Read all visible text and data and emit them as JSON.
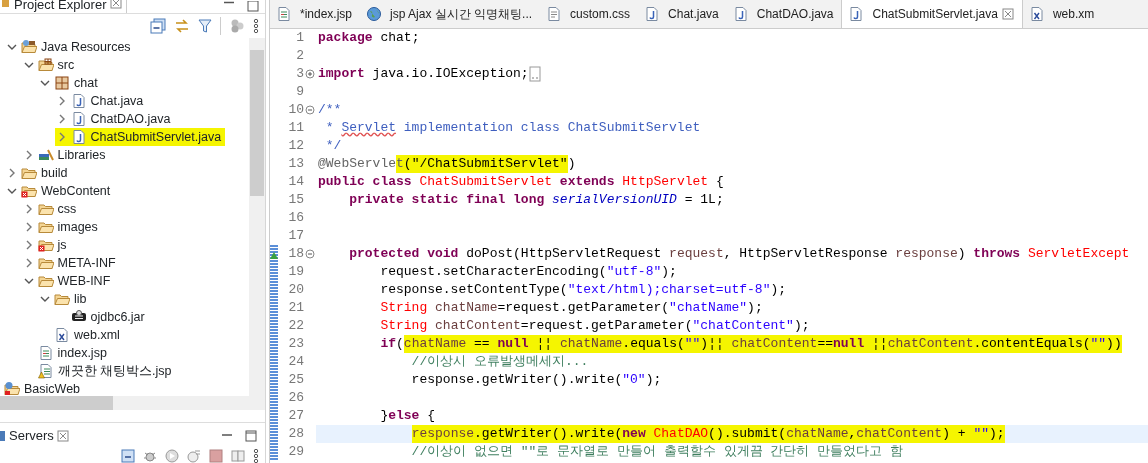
{
  "explorer": {
    "title": "Project Explorer",
    "tree": [
      {
        "label": "Java Resources",
        "kind": "javares",
        "expanded": true,
        "highlighted": false,
        "children": [
          {
            "label": "src",
            "kind": "srcfolder",
            "expanded": true,
            "highlighted": false,
            "children": [
              {
                "label": "chat",
                "kind": "package",
                "expanded": true,
                "highlighted": false,
                "children": [
                  {
                    "label": "Chat.java",
                    "kind": "java",
                    "expanded": false,
                    "highlighted": false
                  },
                  {
                    "label": "ChatDAO.java",
                    "kind": "java",
                    "expanded": false,
                    "highlighted": false
                  },
                  {
                    "label": "ChatSubmitServlet.java",
                    "kind": "java",
                    "expanded": false,
                    "highlighted": true
                  }
                ]
              }
            ]
          },
          {
            "label": "Libraries",
            "kind": "libraries",
            "expanded": false,
            "highlighted": false
          }
        ]
      },
      {
        "label": "build",
        "kind": "folder",
        "expanded": false,
        "highlighted": false
      },
      {
        "label": "WebContent",
        "kind": "webfolder",
        "expanded": true,
        "highlighted": false,
        "children": [
          {
            "label": "css",
            "kind": "folder",
            "expanded": false,
            "highlighted": false
          },
          {
            "label": "images",
            "kind": "folder",
            "expanded": false,
            "highlighted": false
          },
          {
            "label": "js",
            "kind": "webfolder",
            "expanded": false,
            "highlighted": false
          },
          {
            "label": "META-INF",
            "kind": "folder",
            "expanded": false,
            "highlighted": false
          },
          {
            "label": "WEB-INF",
            "kind": "folder",
            "expanded": true,
            "highlighted": false,
            "children": [
              {
                "label": "lib",
                "kind": "folder",
                "expanded": true,
                "highlighted": false,
                "children": [
                  {
                    "label": "ojdbc6.jar",
                    "kind": "jar",
                    "highlighted": false
                  }
                ]
              },
              {
                "label": "web.xml",
                "kind": "xml",
                "highlighted": false
              }
            ]
          },
          {
            "label": "index.jsp",
            "kind": "jsp",
            "highlighted": false
          },
          {
            "label": "깨끗한 채팅박스.jsp",
            "kind": "jspwarn",
            "highlighted": false
          }
        ]
      }
    ],
    "projects": [
      {
        "label": "BasicWeb",
        "kind": "project"
      }
    ]
  },
  "servers": {
    "title": "Servers"
  },
  "editor": {
    "tabs": [
      {
        "label": "*index.jsp",
        "kind": "jsp",
        "selected": false
      },
      {
        "label": "jsp Ajax 실시간 익명채팅...",
        "kind": "globe",
        "selected": false
      },
      {
        "label": "custom.css",
        "kind": "css",
        "selected": false
      },
      {
        "label": "Chat.java",
        "kind": "java",
        "selected": false
      },
      {
        "label": "ChatDAO.java",
        "kind": "java",
        "selected": false
      },
      {
        "label": "ChatSubmitServlet.java",
        "kind": "java",
        "selected": true
      },
      {
        "label": "web.xm",
        "kind": "xml",
        "selected": false
      }
    ],
    "lines": [
      {
        "n": "1",
        "range": false,
        "current": false,
        "tokens": [
          {
            "text": "package ",
            "kind": "kw",
            "highlighted": false
          },
          {
            "text": "chat;",
            "kind": "plain",
            "highlighted": false
          }
        ]
      },
      {
        "n": "2",
        "range": false,
        "current": false
      },
      {
        "n": "3",
        "fold": {
          "collapsed": true
        },
        "folded": true,
        "range": false,
        "current": false,
        "tokens": [
          {
            "text": "import ",
            "kind": "kw",
            "highlighted": false
          },
          {
            "text": "java.io.IOException;",
            "kind": "plain",
            "highlighted": false
          }
        ]
      },
      {
        "n": "9",
        "range": false,
        "current": false
      },
      {
        "n": "10",
        "fold": {
          "collapsed": false
        },
        "range": false,
        "current": false,
        "tokens": [
          {
            "text": "/**",
            "kind": "javadoc",
            "highlighted": false
          }
        ]
      },
      {
        "n": "11",
        "range": false,
        "current": false,
        "tokens": [
          {
            "text": " * ",
            "kind": "javadoc",
            "highlighted": false
          },
          {
            "text": "Servlet",
            "kind": "misspelled",
            "highlighted": false
          },
          {
            "text": " implementation class ChatSubmitServlet",
            "kind": "javadoc",
            "highlighted": false
          }
        ]
      },
      {
        "n": "12",
        "range": false,
        "current": false,
        "tokens": [
          {
            "text": " */",
            "kind": "javadoc",
            "highlighted": false
          }
        ]
      },
      {
        "n": "13",
        "range": false,
        "current": false,
        "tokens": [
          {
            "text": "@WebServle",
            "kind": "annotation",
            "highlighted": false
          },
          {
            "text": "t",
            "kind": "annotation",
            "highlighted": true
          },
          {
            "text": "(\"/ChatSubmitServlet\"",
            "kind": "plain",
            "highlighted": true
          },
          {
            "text": ")",
            "kind": "plain",
            "highlighted": false
          }
        ]
      },
      {
        "n": "14",
        "range": false,
        "current": false,
        "tokens": [
          {
            "text": "public class ",
            "kind": "kw",
            "highlighted": false
          },
          {
            "text": "ChatSubmitServlet ",
            "kind": "type",
            "highlighted": false
          },
          {
            "text": "extends ",
            "kind": "kw",
            "highlighted": false
          },
          {
            "text": "HttpServlet",
            "kind": "type",
            "highlighted": false
          },
          {
            "text": " {",
            "kind": "plain",
            "highlighted": false
          }
        ]
      },
      {
        "n": "15",
        "range": false,
        "current": false,
        "tokens": [
          {
            "text": "    private static final long ",
            "kind": "kw",
            "highlighted": false
          },
          {
            "text": "serialVersionUID",
            "kind": "field",
            "highlighted": false
          },
          {
            "text": " = 1L;",
            "kind": "plain",
            "highlighted": false
          }
        ]
      },
      {
        "n": "16",
        "range": false,
        "current": false
      },
      {
        "n": "17",
        "range": false,
        "current": false
      },
      {
        "n": "18",
        "fold": {
          "collapsed": false
        },
        "override": true,
        "range": true,
        "current": false,
        "tokens": [
          {
            "text": "    protected void",
            "kind": "kw",
            "highlighted": false
          },
          {
            "text": " doPost(HttpServletRequest ",
            "kind": "plain",
            "highlighted": false
          },
          {
            "text": "request",
            "kind": "var",
            "highlighted": false
          },
          {
            "text": ", HttpServletResponse ",
            "kind": "plain",
            "highlighted": false
          },
          {
            "text": "response",
            "kind": "var",
            "highlighted": false
          },
          {
            "text": ") ",
            "kind": "plain",
            "highlighted": false
          },
          {
            "text": "throws ",
            "kind": "kw",
            "highlighted": false
          },
          {
            "text": "ServletExcept",
            "kind": "type",
            "highlighted": false
          }
        ]
      },
      {
        "n": "19",
        "range": true,
        "current": false,
        "tokens": [
          {
            "text": "        request.setCharacterEncoding(",
            "kind": "plain",
            "highlighted": false
          },
          {
            "text": "\"utf-8\"",
            "kind": "str",
            "highlighted": false
          },
          {
            "text": ");",
            "kind": "plain",
            "highlighted": false
          }
        ]
      },
      {
        "n": "20",
        "range": true,
        "current": false,
        "tokens": [
          {
            "text": "        response.setContentType(",
            "kind": "plain",
            "highlighted": false
          },
          {
            "text": "\"text/html);charset=utf-8\"",
            "kind": "str",
            "highlighted": false
          },
          {
            "text": ");",
            "kind": "plain",
            "highlighted": false
          }
        ]
      },
      {
        "n": "21",
        "range": true,
        "current": false,
        "tokens": [
          {
            "text": "        String ",
            "kind": "type",
            "highlighted": false
          },
          {
            "text": "chatName",
            "kind": "var",
            "highlighted": false
          },
          {
            "text": "=request.getParameter(",
            "kind": "plain",
            "highlighted": false
          },
          {
            "text": "\"chatName\"",
            "kind": "str",
            "highlighted": false
          },
          {
            "text": ");",
            "kind": "plain",
            "highlighted": false
          }
        ]
      },
      {
        "n": "22",
        "range": true,
        "current": false,
        "tokens": [
          {
            "text": "        String ",
            "kind": "type",
            "highlighted": false
          },
          {
            "text": "chatContent",
            "kind": "var",
            "highlighted": false
          },
          {
            "text": "=request.getParameter(",
            "kind": "plain",
            "highlighted": false
          },
          {
            "text": "\"chatContent\"",
            "kind": "str",
            "highlighted": false
          },
          {
            "text": ");",
            "kind": "plain",
            "highlighted": false
          }
        ]
      },
      {
        "n": "23",
        "range": true,
        "current": false,
        "tokens": [
          {
            "text": "        if",
            "kind": "kw",
            "highlighted": false
          },
          {
            "text": "(",
            "kind": "plain",
            "highlighted": false
          },
          {
            "text": "chatName",
            "kind": "var",
            "highlighted": true
          },
          {
            "text": " == ",
            "kind": "plain",
            "highlighted": true
          },
          {
            "text": "null",
            "kind": "kw",
            "highlighted": true
          },
          {
            "text": " ¦¦ ",
            "kind": "plain",
            "highlighted": true
          },
          {
            "text": "chatName",
            "kind": "var",
            "highlighted": true
          },
          {
            "text": ".equals(",
            "kind": "plain",
            "highlighted": true
          },
          {
            "text": "\"\"",
            "kind": "str",
            "highlighted": true
          },
          {
            "text": ")¦¦ ",
            "kind": "plain",
            "highlighted": true
          },
          {
            "text": "chatContent",
            "kind": "var",
            "highlighted": true
          },
          {
            "text": "==",
            "kind": "plain",
            "highlighted": true
          },
          {
            "text": "null",
            "kind": "kw",
            "highlighted": true
          },
          {
            "text": " ¦¦",
            "kind": "plain",
            "highlighted": true
          },
          {
            "text": "chatContent",
            "kind": "var",
            "highlighted": true
          },
          {
            "text": ".contentEquals(",
            "kind": "plain",
            "highlighted": true
          },
          {
            "text": "\"\"",
            "kind": "str",
            "highlighted": true
          },
          {
            "text": "))",
            "kind": "plain",
            "highlighted": true
          }
        ]
      },
      {
        "n": "24",
        "range": true,
        "current": false,
        "tokens": [
          {
            "text": "            //이상시 오류발생메세지...",
            "kind": "comment",
            "highlighted": false
          }
        ]
      },
      {
        "n": "25",
        "range": true,
        "current": false,
        "tokens": [
          {
            "text": "            response.getWriter().write(",
            "kind": "plain",
            "highlighted": false
          },
          {
            "text": "\"0\"",
            "kind": "str",
            "highlighted": false
          },
          {
            "text": ");",
            "kind": "plain",
            "highlighted": false
          }
        ]
      },
      {
        "n": "26",
        "range": true,
        "current": false
      },
      {
        "n": "27",
        "range": true,
        "current": false,
        "tokens": [
          {
            "text": "        }",
            "kind": "plain",
            "highlighted": false
          },
          {
            "text": "else",
            "kind": "kw",
            "highlighted": false
          },
          {
            "text": " {",
            "kind": "plain",
            "highlighted": false
          }
        ]
      },
      {
        "n": "28",
        "range": true,
        "current": true,
        "tokens": [
          {
            "text": "            response",
            "kind": "var",
            "highlighted": true
          },
          {
            "text": ".getWriter().write(",
            "kind": "plain",
            "highlighted": true
          },
          {
            "text": "new ",
            "kind": "kw",
            "highlighted": true
          },
          {
            "text": "ChatDAO",
            "kind": "type",
            "highlighted": true
          },
          {
            "text": "().submit(",
            "kind": "plain",
            "highlighted": true
          },
          {
            "text": "chatName",
            "kind": "var",
            "highlighted": true
          },
          {
            "text": ",",
            "kind": "plain",
            "highlighted": true
          },
          {
            "text": "chatContent",
            "kind": "var",
            "highlighted": true
          },
          {
            "text": ") + ",
            "kind": "plain",
            "highlighted": true
          },
          {
            "text": "\"\"",
            "kind": "str",
            "highlighted": true
          },
          {
            "text": ");",
            "kind": "plain",
            "highlighted": true
          }
        ]
      },
      {
        "n": "29",
        "range": true,
        "current": false,
        "tokens": [
          {
            "text": "            //이상이 없으면 \"\"로 문자열로 만들어 출력할수 있게끔 간단히 만들었다고 함",
            "kind": "comment",
            "highlighted": false
          }
        ]
      }
    ]
  }
}
